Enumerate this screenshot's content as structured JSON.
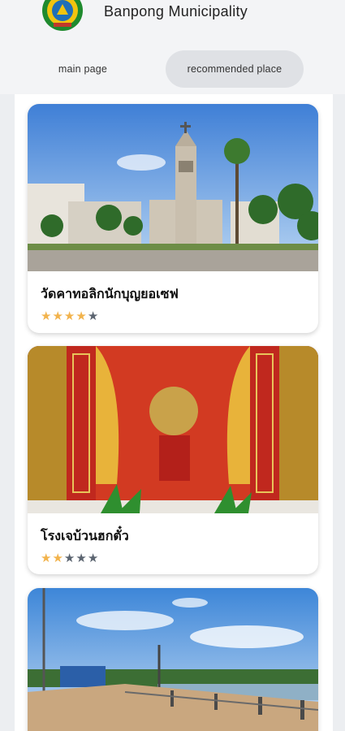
{
  "header": {
    "title": "Banpong Municipality",
    "logo_icon": "municipality-seal"
  },
  "tabs": [
    {
      "label": "main page",
      "active": false
    },
    {
      "label": "recommended place",
      "active": true
    }
  ],
  "places": [
    {
      "name": "วัดคาทอลิกนักบุญยอเซฟ",
      "rating": 4,
      "max_rating": 5,
      "image": "church-photo"
    },
    {
      "name": "โรงเจบ้วนฮกตั๋ว",
      "rating": 2,
      "max_rating": 5,
      "image": "shrine-photo"
    },
    {
      "name": "",
      "rating": null,
      "max_rating": 5,
      "image": "riverside-walkway-photo"
    }
  ],
  "colors": {
    "star_filled": "#f2b34c",
    "star_empty": "#5b6470",
    "active_tab_bg": "#dfe1e5",
    "header_bg": "#f3f4f6"
  }
}
